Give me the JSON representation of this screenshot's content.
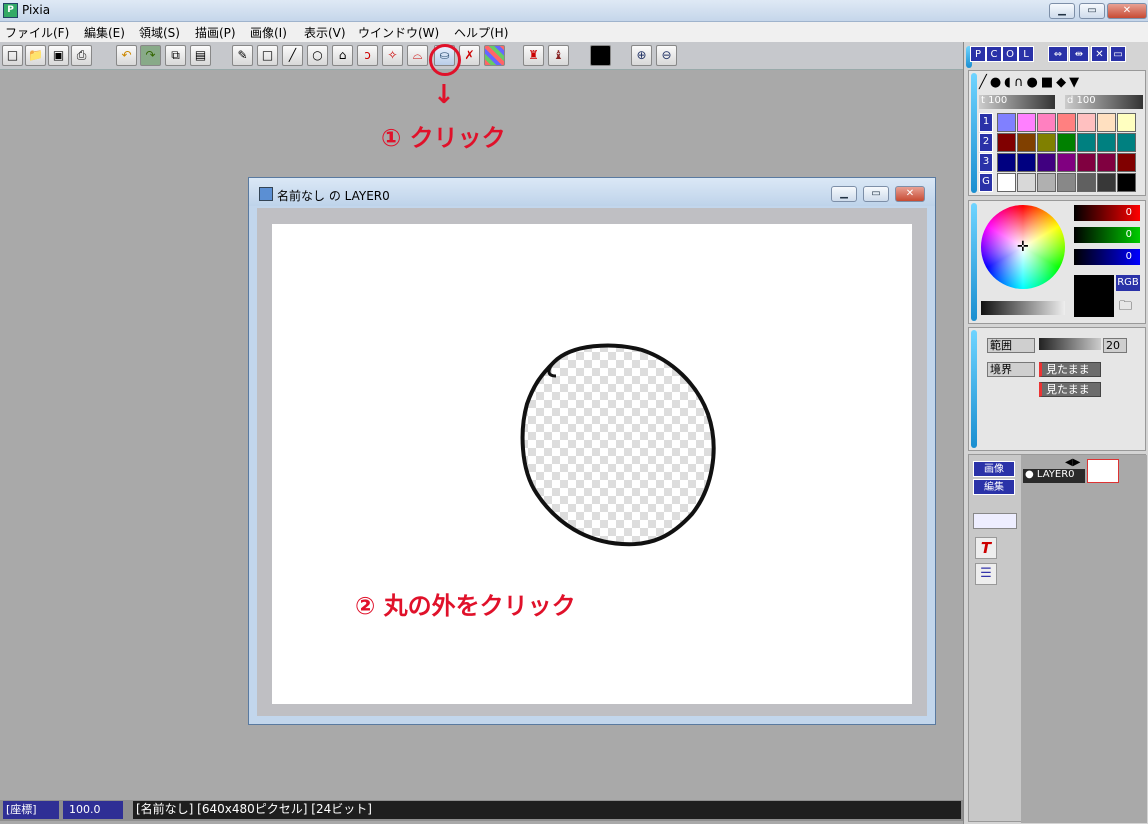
{
  "app": {
    "title": "Pixia"
  },
  "menu": [
    "ファイル(F)",
    "編集(E)",
    "領域(S)",
    "描画(P)",
    "画像(I)",
    "表示(V)",
    "ウインドウ(W)",
    "ヘルプ(H)"
  ],
  "toolbar": {
    "icons": [
      "new-file-icon",
      "open-folder-icon",
      "save-icon",
      "print-icon",
      "undo-icon",
      "redo-icon",
      "copy-icon",
      "paste-icon",
      "pen-icon",
      "rectangle-icon",
      "line-icon",
      "ellipse-icon",
      "freehand-select-icon",
      "lasso-icon",
      "magic-wand-icon",
      "fill-select-icon",
      "bucket-select-icon",
      "deselect-icon",
      "mosaic-icon",
      "stamp-icon",
      "eraser-stamp-icon",
      "color-swatch-icon",
      "zoom-in-icon",
      "zoom-out-icon"
    ]
  },
  "annotations": {
    "step1": "① クリック",
    "step2": "② 丸の外をクリック",
    "arrow": "↓"
  },
  "document": {
    "title": "名前なし の LAYER0"
  },
  "palette": {
    "tabs": [
      "P",
      "C",
      "O",
      "L"
    ],
    "thickness_label": "t",
    "thickness_value": "100",
    "density_label": "d",
    "density_value": "100",
    "row_labels": [
      "1",
      "2",
      "3",
      "G"
    ],
    "rows": [
      [
        "#8080ff",
        "#ff80ff",
        "#ff80c0",
        "#ff8080",
        "#ffc0c0",
        "#ffe0c0",
        "#ffffc0"
      ],
      [
        "#800000",
        "#804000",
        "#808000",
        "#008000",
        "#008080",
        "#008080",
        "#008080"
      ],
      [
        "#000080",
        "#000080",
        "#400080",
        "#800080",
        "#800040",
        "#800040",
        "#800000"
      ],
      [
        "#ffffff",
        "#d8d8d8",
        "#b0b0b0",
        "#888888",
        "#606060",
        "#383838",
        "#000000"
      ]
    ]
  },
  "color": {
    "r": "0",
    "g": "0",
    "b": "0",
    "mode": "RGB"
  },
  "selection": {
    "range_label": "範囲",
    "range_value": "20",
    "border_label": "境界",
    "option1": "見たまま",
    "option2": "見たまま"
  },
  "layers": {
    "image_btn": "画像",
    "edit_btn": "編集",
    "layer_name": "LAYER0"
  },
  "status": {
    "coords": "[座標]",
    "zoom": "100.0",
    "info": "[名前なし] [640x480ピクセル] [24ビット]"
  }
}
